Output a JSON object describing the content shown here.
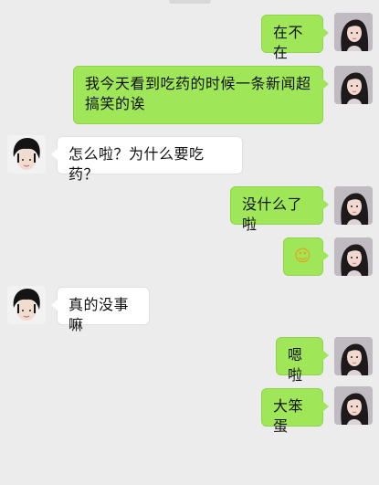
{
  "messages": [
    {
      "sender": "me",
      "text": "在不在"
    },
    {
      "sender": "me",
      "text": "我今天看到吃药的时候一条新闻超搞笑的诶"
    },
    {
      "sender": "friend",
      "text": "怎么啦？为什么要吃药？"
    },
    {
      "sender": "me",
      "text": "没什么了啦"
    },
    {
      "sender": "me",
      "emoji": "smiling-blush",
      "text": "☺"
    },
    {
      "sender": "friend",
      "text": "真的没事嘛"
    },
    {
      "sender": "me",
      "text": "嗯啦"
    },
    {
      "sender": "me",
      "text": "大笨蛋"
    }
  ],
  "colors": {
    "background": "#ececec",
    "my_bubble": "#9fe658",
    "friend_bubble": "#ffffff"
  },
  "icons": {
    "my_avatar": "avatar-long-dark-hair-girl",
    "friend_avatar": "avatar-black-hair-boy"
  }
}
